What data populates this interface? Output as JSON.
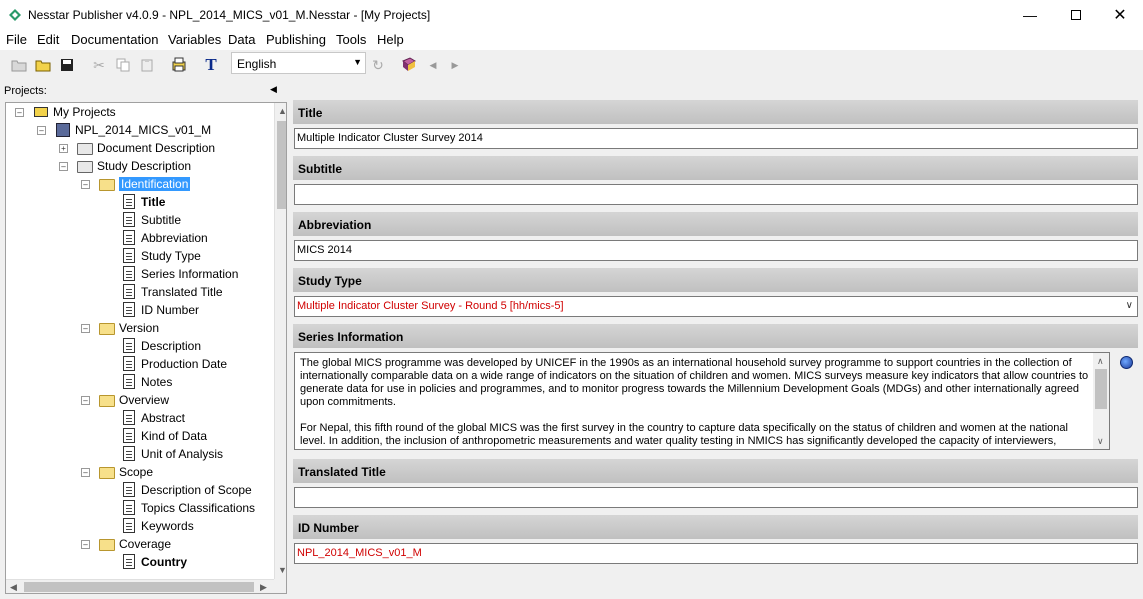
{
  "window": {
    "title": "Nesstar Publisher v4.0.9 - NPL_2014_MICS_v01_M.Nesstar - [My Projects]"
  },
  "menu": [
    "File",
    "Edit",
    "Documentation",
    "Variables",
    "Data",
    "Publishing",
    "Tools",
    "Help"
  ],
  "toolbar": {
    "language": "English",
    "text_tool": "T"
  },
  "projects_label": "Projects:",
  "tree": [
    {
      "label": "My Projects"
    },
    {
      "label": "NPL_2014_MICS_v01_M"
    },
    {
      "label": "Document Description"
    },
    {
      "label": "Study Description"
    },
    {
      "label": "Identification"
    },
    {
      "label": "Title"
    },
    {
      "label": "Subtitle"
    },
    {
      "label": "Abbreviation"
    },
    {
      "label": "Study Type"
    },
    {
      "label": "Series Information"
    },
    {
      "label": "Translated Title"
    },
    {
      "label": "ID Number"
    },
    {
      "label": "Version"
    },
    {
      "label": "Description"
    },
    {
      "label": "Production Date"
    },
    {
      "label": "Notes"
    },
    {
      "label": "Overview"
    },
    {
      "label": "Abstract"
    },
    {
      "label": "Kind of Data"
    },
    {
      "label": "Unit of Analysis"
    },
    {
      "label": "Scope"
    },
    {
      "label": "Description of Scope"
    },
    {
      "label": "Topics Classifications"
    },
    {
      "label": "Keywords"
    },
    {
      "label": "Coverage"
    },
    {
      "label": "Country"
    }
  ],
  "fields": {
    "title": {
      "label": "Title",
      "value": "Multiple Indicator Cluster Survey 2014"
    },
    "subtitle": {
      "label": "Subtitle",
      "value": ""
    },
    "abbreviation": {
      "label": "Abbreviation",
      "value": "MICS 2014"
    },
    "study_type": {
      "label": "Study Type",
      "value": "Multiple Indicator Cluster Survey - Round 5 [hh/mics-5]"
    },
    "series_information": {
      "label": "Series Information",
      "paragraph1": "The global MICS programme was developed by UNICEF in the 1990s as an international household survey programme to support countries in the collection of internationally comparable data on a wide range of indicators on the situation of children and women. MICS surveys measure key indicators that allow countries to generate data for use in policies and programmes, and to monitor progress towards the Millennium Development Goals (MDGs) and other internationally agreed upon commitments.",
      "paragraph2": "For Nepal, this fifth round of the global MICS was the first survey in the country to capture data specifically on the status of children and women at the national level. In addition, the inclusion of anthropometric measurements and water quality  testing in NMICS has significantly developed  the capacity of interviewers,"
    },
    "translated_title": {
      "label": "Translated Title",
      "value": ""
    },
    "id_number": {
      "label": "ID Number",
      "value": "NPL_2014_MICS_v01_M"
    }
  },
  "colors": {
    "selection": "#3399ff",
    "required_text": "#d00000",
    "header_bg": "#c8c8c8"
  }
}
